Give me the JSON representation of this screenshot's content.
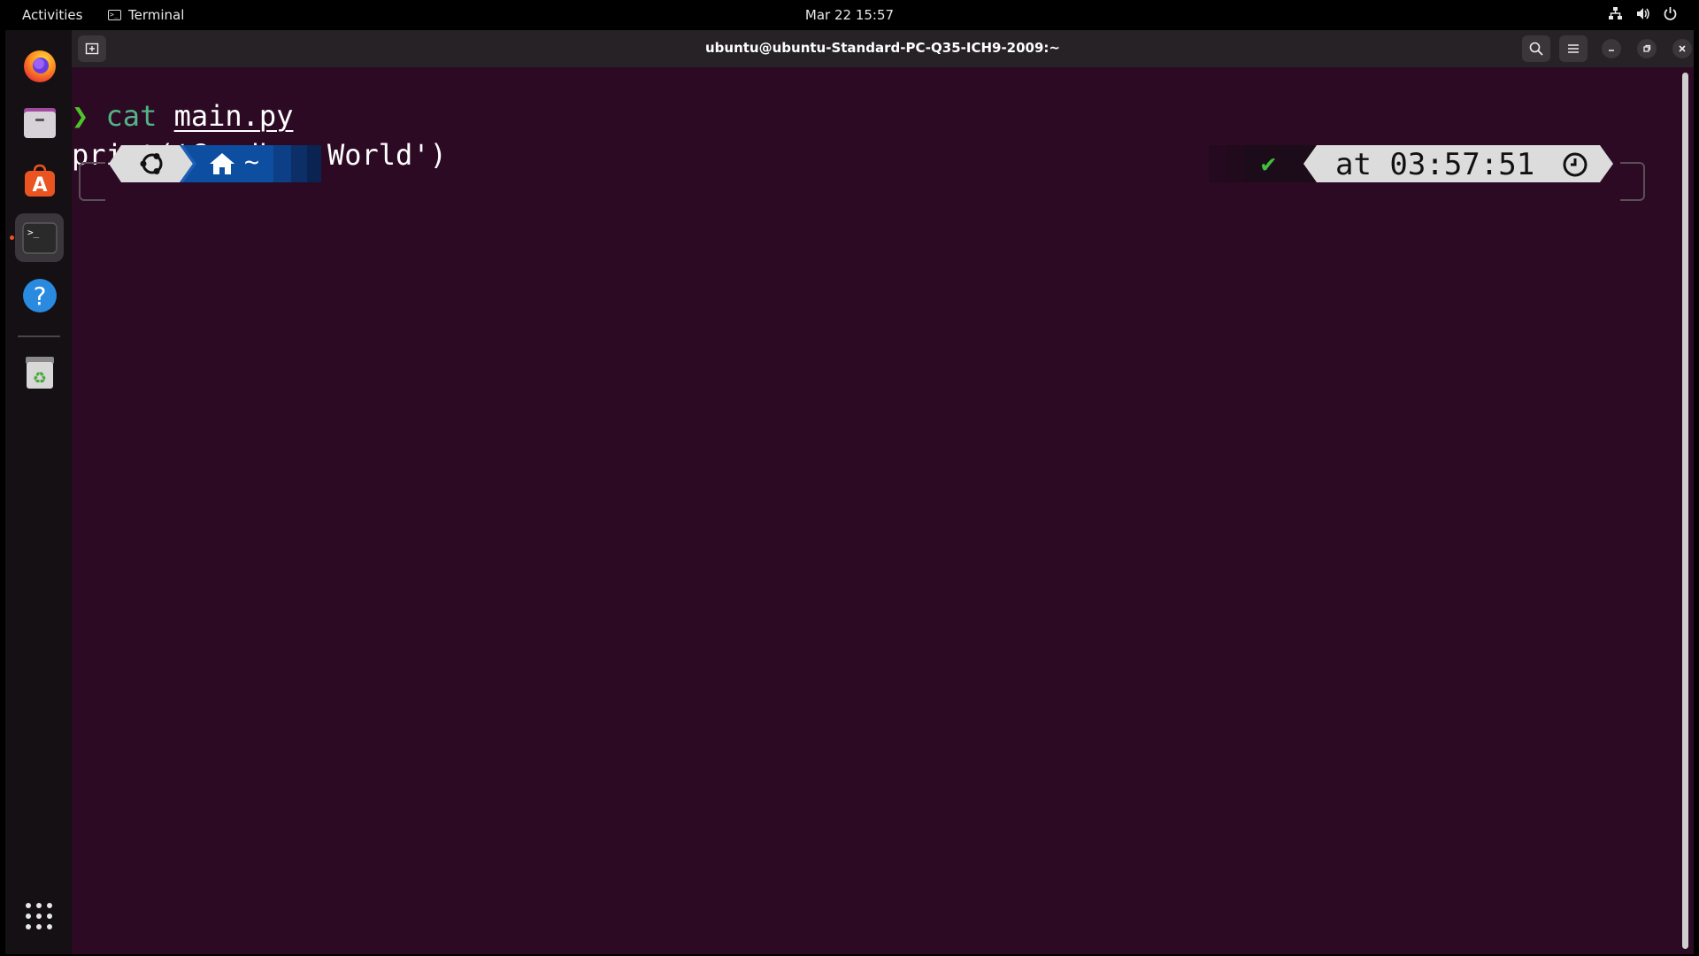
{
  "topbar": {
    "activities": "Activities",
    "app_name": "Terminal",
    "datetime": "Mar 22  15:57",
    "tray_icons": [
      "network-icon",
      "volume-icon",
      "power-icon"
    ]
  },
  "dock": {
    "items": [
      {
        "name": "firefox-icon",
        "label": "Firefox"
      },
      {
        "name": "files-icon",
        "label": "Files"
      },
      {
        "name": "app-center-icon",
        "label": "Ubuntu Software"
      },
      {
        "name": "terminal-icon",
        "label": "Terminal"
      },
      {
        "name": "help-icon",
        "label": "Help"
      },
      {
        "name": "trash-icon",
        "label": "Trash"
      }
    ],
    "show_apps": "show-apps-icon"
  },
  "window": {
    "title": "ubuntu@ubuntu-Standard-PC-Q35-ICH9-2009:~"
  },
  "terminal": {
    "prompt_char": "❯",
    "command": "cat",
    "argument": "main.py",
    "output": "print('Goodbye World')",
    "home_symbol": "~",
    "status_check": "✔",
    "time_label": "at 03:57:51"
  },
  "colors": {
    "terminal_bg": "#2c0a24",
    "prompt_green": "#4ec42a",
    "dir_blue": "#0e4ea0",
    "accent_orange": "#e95420"
  }
}
